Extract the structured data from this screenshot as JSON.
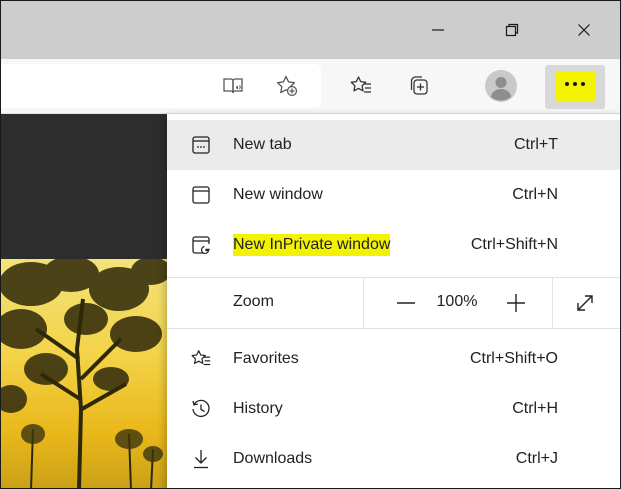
{
  "menu": {
    "items": [
      {
        "label": "New tab",
        "shortcut": "Ctrl+T"
      },
      {
        "label": "New window",
        "shortcut": "Ctrl+N"
      },
      {
        "label": "New InPrivate window",
        "shortcut": "Ctrl+Shift+N"
      },
      {
        "label": "Favorites",
        "shortcut": "Ctrl+Shift+O"
      },
      {
        "label": "History",
        "shortcut": "Ctrl+H"
      },
      {
        "label": "Downloads",
        "shortcut": "Ctrl+J"
      }
    ],
    "zoom": {
      "label": "Zoom",
      "value": "100%"
    }
  },
  "icons": {
    "minimize": "minimize-icon",
    "restore": "restore-icon",
    "close": "close-icon",
    "reader": "immersive-reader-icon",
    "add_favorite": "add-favorite-icon",
    "favorites": "favorites-icon",
    "collections": "collections-icon",
    "profile": "profile-avatar",
    "more": "more-dots-icon"
  },
  "colors": {
    "highlight": "#f3f300",
    "titlebar": "#cdcdcd",
    "menu_hover": "#ebebeb"
  }
}
